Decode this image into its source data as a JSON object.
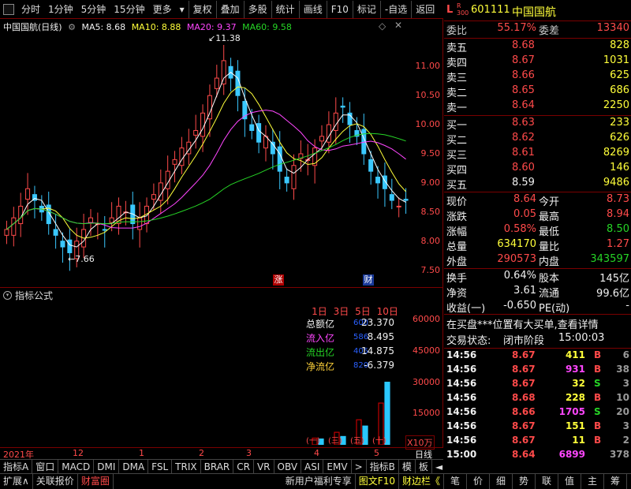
{
  "toolbar": {
    "items": [
      "分时",
      "1分钟",
      "5分钟",
      "15分钟",
      "更多"
    ],
    "tools": [
      "复权",
      "叠加",
      "多股",
      "统计",
      "画线",
      "F10",
      "标记",
      "-自选",
      "返回"
    ]
  },
  "chart_title": {
    "name": "中国国航(日线)",
    "ma5": "MA5: 8.68",
    "ma10": "MA10: 8.88",
    "ma20": "MA20: 9.37",
    "ma60": "MA60: 9.58"
  },
  "annotations": {
    "high": "11.38",
    "low": "7.66",
    "rise_badge": "涨",
    "fin_badge": "财"
  },
  "indicator": {
    "label": "指标公式"
  },
  "flow": {
    "periods": [
      "1日",
      "3日",
      "5日",
      "10日"
    ],
    "rows": [
      {
        "label": "总额亿",
        "value": "23.370",
        "color": "#f0f0f0"
      },
      {
        "label": "流入亿",
        "value": "8.495",
        "color": "#ff46ff"
      },
      {
        "label": "流出亿",
        "value": "14.875",
        "color": "#26d526"
      },
      {
        "label": "净流亿",
        "value": "-6.379",
        "color": "#ffd23a"
      }
    ],
    "ghost": [
      "600",
      "586",
      "405",
      "820"
    ],
    "bottom": [
      "(一)",
      "(三)",
      "(五)",
      "(十)"
    ],
    "unit": "X10万"
  },
  "chart_data": [
    {
      "type": "candlestick",
      "title": "",
      "ylim": [
        7.4,
        11.6
      ],
      "yticks": [
        "11.00",
        "10.50",
        "10.00",
        "9.50",
        "9.00",
        "8.50",
        "8.00",
        "7.50"
      ],
      "xticks": [
        "2021年",
        "12",
        "1",
        "2",
        "3",
        "4",
        "5",
        "日线"
      ],
      "series": [
        {
          "values": [
            8.2,
            8.4,
            8.6,
            8.9,
            8.7,
            8.5,
            8.3,
            8.1,
            7.9,
            7.8,
            8.0,
            8.2,
            8.4,
            8.3,
            8.2,
            8.4,
            8.6,
            8.5,
            8.3,
            8.4,
            8.6,
            8.8,
            9.0,
            9.2,
            9.4,
            9.6,
            9.7,
            9.9,
            10.2,
            10.5,
            10.8,
            11.1,
            10.8,
            10.5,
            10.1,
            9.9,
            9.7,
            9.8,
            9.5,
            9.2,
            9.0,
            9.3,
            9.5,
            9.4,
            9.6,
            9.8,
            10.0,
            10.2,
            10.3,
            10.0,
            9.8,
            9.5,
            9.2,
            9.0,
            8.9,
            8.7,
            8.6,
            8.7
          ]
        }
      ]
    },
    {
      "type": "bar",
      "title": "",
      "yticks": [
        "60000",
        "45000",
        "30000",
        "15000"
      ],
      "ylim": [
        0,
        68000
      ],
      "series": [
        {
          "name": "",
          "values": [
            3200,
            6000,
            12000,
            20000
          ]
        },
        {
          "name": "",
          "values": [
            2800,
            4000,
            9000,
            30000
          ]
        }
      ]
    }
  ],
  "quote": {
    "marker": "L",
    "marker_sub": "R 300",
    "code": "601111",
    "name": "中国国航",
    "weibi_label": "委比",
    "weibi": "55.17%",
    "weicha_label": "委差",
    "weicha": "13340",
    "sell": [
      {
        "label": "卖五",
        "price": "8.68",
        "vol": "828"
      },
      {
        "label": "卖四",
        "price": "8.67",
        "vol": "1031"
      },
      {
        "label": "卖三",
        "price": "8.66",
        "vol": "625"
      },
      {
        "label": "卖二",
        "price": "8.65",
        "vol": "686"
      },
      {
        "label": "卖一",
        "price": "8.64",
        "vol": "2250"
      }
    ],
    "buy": [
      {
        "label": "买一",
        "price": "8.63",
        "vol": "233"
      },
      {
        "label": "买二",
        "price": "8.62",
        "vol": "626"
      },
      {
        "label": "买三",
        "price": "8.61",
        "vol": "8269"
      },
      {
        "label": "买四",
        "price": "8.60",
        "vol": "146"
      },
      {
        "label": "买五",
        "price": "8.59",
        "vol": "9486"
      }
    ],
    "stats": [
      {
        "l1": "现价",
        "v1": "8.64",
        "c1": "#ff4a4a",
        "l2": "今开",
        "v2": "8.73",
        "c2": "#ff4a4a"
      },
      {
        "l1": "涨跌",
        "v1": "0.05",
        "c1": "#ff4a4a",
        "l2": "最高",
        "v2": "8.94",
        "c2": "#ff4a4a"
      },
      {
        "l1": "涨幅",
        "v1": "0.58%",
        "c1": "#ff4a4a",
        "l2": "最低",
        "v2": "8.50",
        "c2": "#26d526"
      },
      {
        "l1": "总量",
        "v1": "634170",
        "c1": "#ffff3a",
        "l2": "量比",
        "v2": "1.27",
        "c2": "#ff4a4a"
      },
      {
        "l1": "外盘",
        "v1": "290573",
        "c1": "#ff4a4a",
        "l2": "内盘",
        "v2": "343597",
        "c2": "#26d526"
      }
    ],
    "stats2": [
      {
        "l1": "换手",
        "v1": "0.64%",
        "l2": "股本",
        "v2": "145亿"
      },
      {
        "l1": "净资",
        "v1": "3.61",
        "l2": "流通",
        "v2": "99.6亿"
      },
      {
        "l1": "收益(一)",
        "v1": "-0.650",
        "l2": "PE(动)",
        "v2": "-"
      }
    ],
    "notice": "在买盘***位置有大买单,查看详情",
    "status_label": "交易状态:",
    "status": "闭市阶段",
    "status_time": "15:00:03",
    "ticks": [
      {
        "time": "14:56",
        "price": "8.67",
        "vol": "411",
        "bs": "B",
        "n": "6",
        "vc": "#ffff3a",
        "bc": "#ff4a4a"
      },
      {
        "time": "14:56",
        "price": "8.67",
        "vol": "931",
        "bs": "B",
        "n": "38",
        "vc": "#ff46ff",
        "bc": "#ff4a4a"
      },
      {
        "time": "14:56",
        "price": "8.67",
        "vol": "32",
        "bs": "S",
        "n": "3",
        "vc": "#ffff3a",
        "bc": "#26d526"
      },
      {
        "time": "14:56",
        "price": "8.68",
        "vol": "228",
        "bs": "B",
        "n": "10",
        "vc": "#ffff3a",
        "bc": "#ff4a4a"
      },
      {
        "time": "14:56",
        "price": "8.66",
        "vol": "1705",
        "bs": "S",
        "n": "20",
        "vc": "#ff46ff",
        "bc": "#26d526"
      },
      {
        "time": "14:56",
        "price": "8.67",
        "vol": "151",
        "bs": "B",
        "n": "3",
        "vc": "#ffff3a",
        "bc": "#ff4a4a"
      },
      {
        "time": "14:56",
        "price": "8.67",
        "vol": "11",
        "bs": "B",
        "n": "2",
        "vc": "#ffff3a",
        "bc": "#ff4a4a"
      },
      {
        "time": "15:00",
        "price": "8.64",
        "vol": "6899",
        "bs": "",
        "n": "378",
        "vc": "#ff46ff",
        "bc": "#ff4a4a"
      }
    ]
  },
  "tabs": [
    "指标A",
    "窗口",
    "MACD",
    "DMI",
    "DMA",
    "FSL",
    "TRIX",
    "BRAR",
    "CR",
    "VR",
    "OBV",
    "ASI",
    "EMV",
    ">",
    "指标B",
    "模",
    "板",
    "◄"
  ],
  "bottom_bar": [
    "扩展∧",
    "关联报价",
    "财富圈"
  ],
  "bottom_promo": [
    "新用户福利专享",
    "图文F10",
    "财边栏《"
  ],
  "right_tabs": [
    "笔",
    "价",
    "细",
    "势",
    "联",
    "值",
    "主",
    "筹"
  ],
  "colors": {
    "up": "#ff4a4a",
    "down": "#26d526",
    "ma5": "#ffffff",
    "ma10": "#ffff3a",
    "ma20": "#ff46ff",
    "ma60": "#26d526"
  }
}
